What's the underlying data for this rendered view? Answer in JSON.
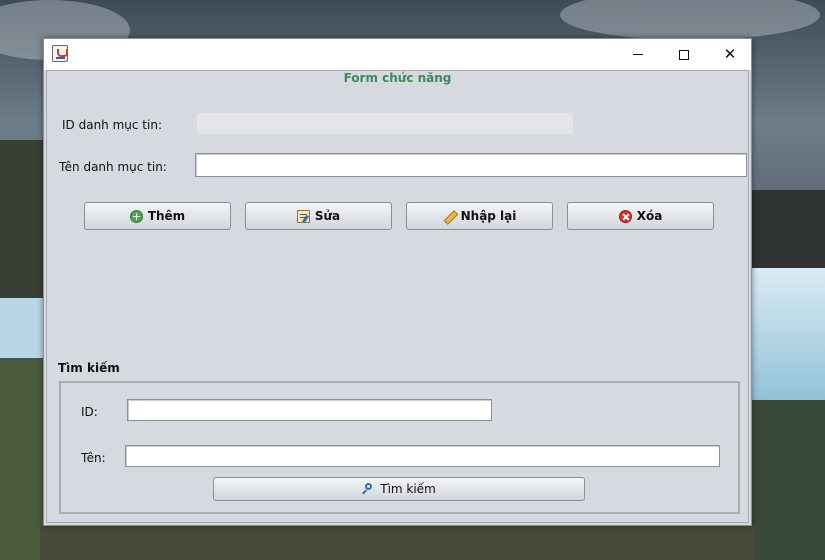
{
  "window": {
    "title": "",
    "controls": {
      "minimize": "minimize",
      "maximize": "maximize",
      "close": "✕"
    }
  },
  "form": {
    "title": "Form chức năng",
    "id_label": "ID danh mục tin:",
    "id_value": "",
    "name_label": "Tên danh mục tin:",
    "name_value": "",
    "buttons": {
      "add": "Thêm",
      "edit": "Sửa",
      "reset": "Nhập lại",
      "delete": "Xóa"
    }
  },
  "search": {
    "title": "Tìm kiếm",
    "id_label": "ID:",
    "id_value": "",
    "name_label": "Tên:",
    "name_value": "",
    "button": "Tìm kiếm"
  },
  "icons": {
    "add": "plus-circle-icon",
    "edit": "edit-document-icon",
    "reset": "pencil-icon",
    "delete": "x-circle-icon",
    "search": "magnifier-icon"
  },
  "colors": {
    "form_title": "#3b8a5a",
    "window_bg": "#d6d9df"
  }
}
